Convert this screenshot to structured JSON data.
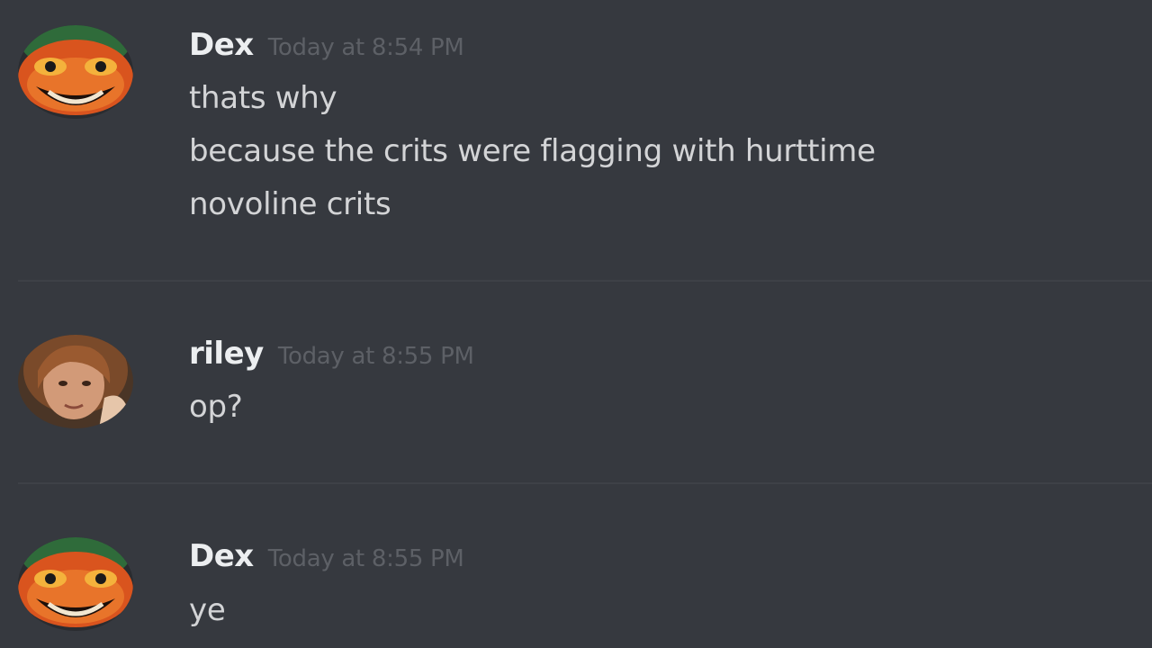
{
  "colors": {
    "background": "#36393f",
    "username": "#eceef0",
    "timestamp": "#5d6066",
    "message_text": "#d3d4d6",
    "divider": "#3e4147"
  },
  "messages": [
    {
      "author": "Dex",
      "timestamp": "Today at 8:54 PM",
      "avatar_icon": "cartoon-face-avatar-icon",
      "lines": [
        "thats why",
        "because the crits were flagging with hurttime",
        "novoline crits"
      ]
    },
    {
      "author": "riley",
      "timestamp": "Today at 8:55 PM",
      "avatar_icon": "photo-avatar-icon",
      "lines": [
        "op?"
      ]
    },
    {
      "author": "Dex",
      "timestamp": "Today at 8:55 PM",
      "avatar_icon": "cartoon-face-avatar-icon",
      "lines": [
        "ye"
      ]
    }
  ]
}
